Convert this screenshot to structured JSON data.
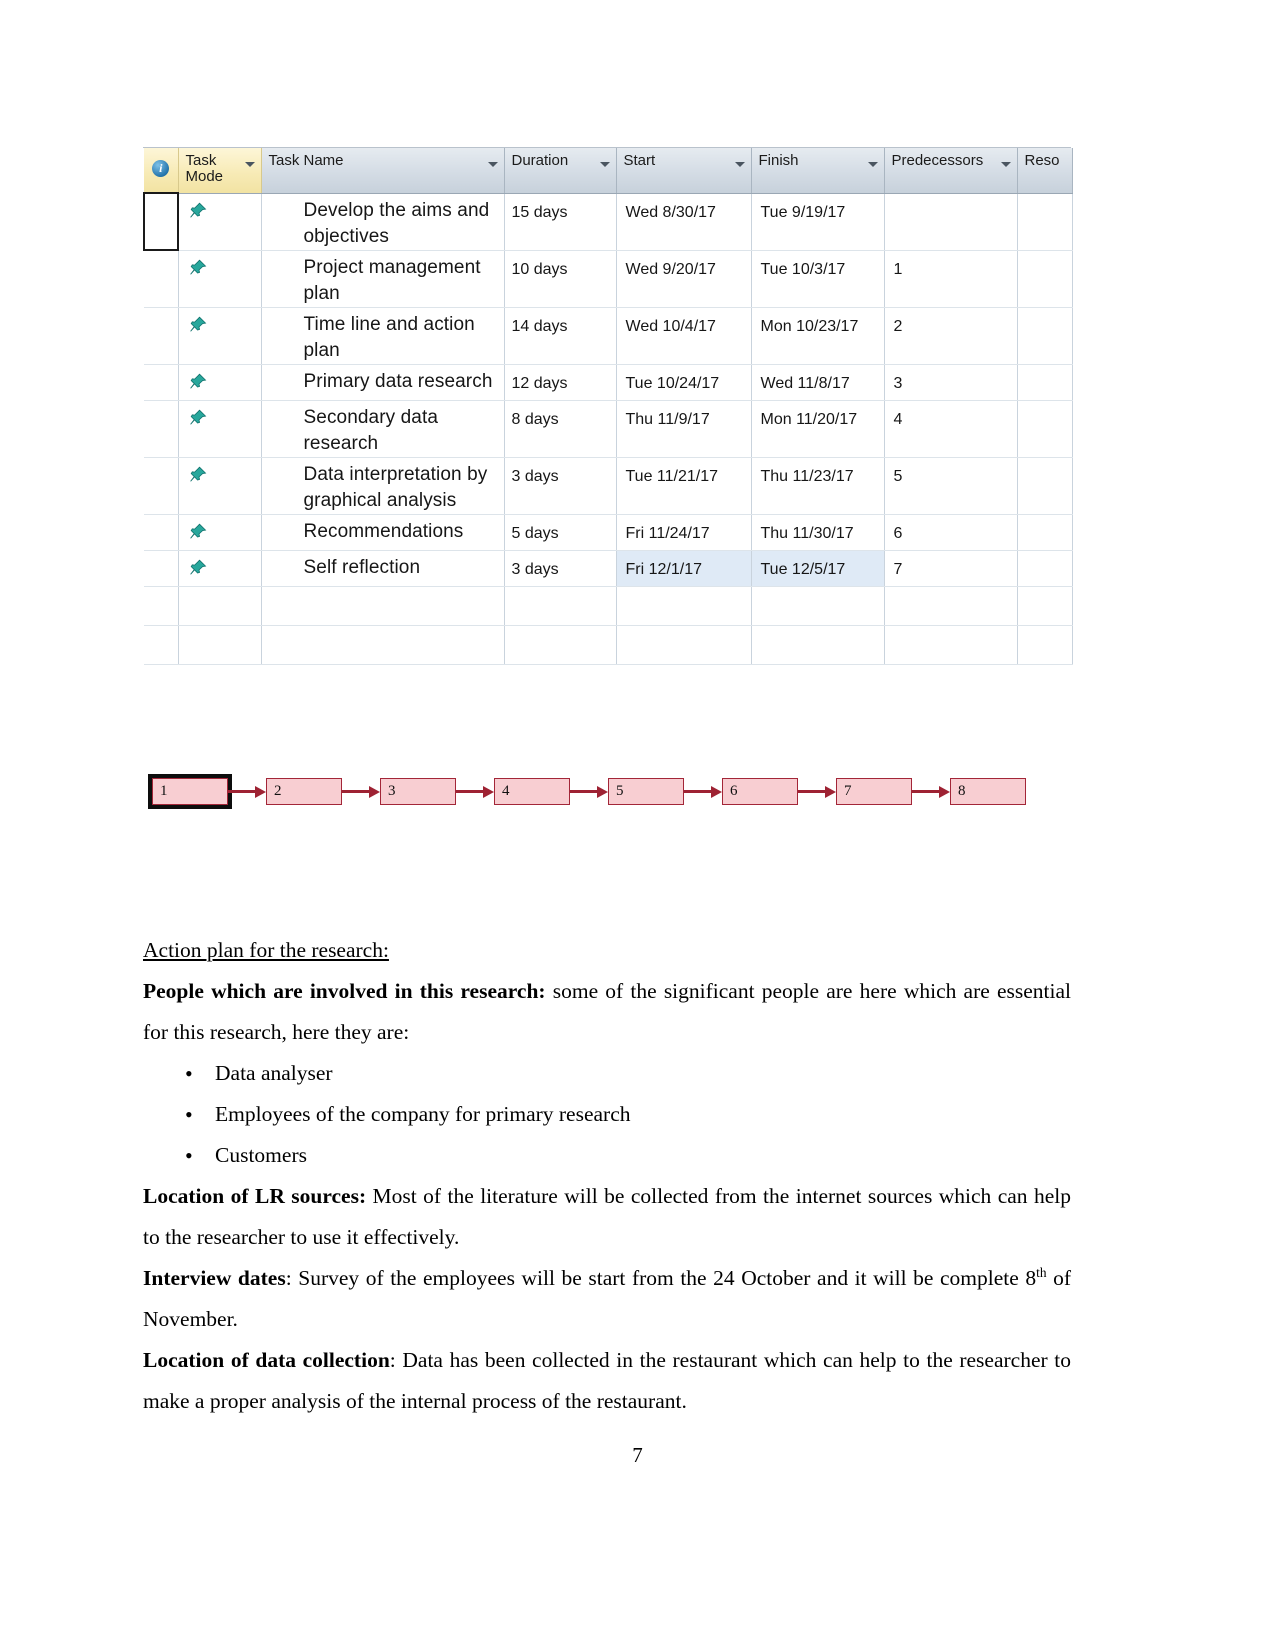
{
  "project_table": {
    "columns": [
      {
        "key": "indicator",
        "label": ""
      },
      {
        "key": "task_mode",
        "label": "Task Mode"
      },
      {
        "key": "task_name",
        "label": "Task Name"
      },
      {
        "key": "duration",
        "label": "Duration"
      },
      {
        "key": "start",
        "label": "Start"
      },
      {
        "key": "finish",
        "label": "Finish"
      },
      {
        "key": "predecessors",
        "label": "Predecessors"
      },
      {
        "key": "resources",
        "label": "Reso"
      }
    ],
    "rows": [
      {
        "task_name": "Develop the aims and objectives",
        "duration": "15 days",
        "start": "Wed 8/30/17",
        "finish": "Tue 9/19/17",
        "predecessors": ""
      },
      {
        "task_name": "Project management plan",
        "duration": "10 days",
        "start": "Wed 9/20/17",
        "finish": "Tue 10/3/17",
        "predecessors": "1"
      },
      {
        "task_name": "Time line and action plan",
        "duration": "14 days",
        "start": "Wed 10/4/17",
        "finish": "Mon 10/23/17",
        "predecessors": "2"
      },
      {
        "task_name": "Primary data research",
        "duration": "12 days",
        "start": "Tue 10/24/17",
        "finish": "Wed 11/8/17",
        "predecessors": "3"
      },
      {
        "task_name": "Secondary data research",
        "duration": "8 days",
        "start": "Thu 11/9/17",
        "finish": "Mon 11/20/17",
        "predecessors": "4"
      },
      {
        "task_name": "Data interpretation by graphical analysis",
        "duration": "3 days",
        "start": "Tue 11/21/17",
        "finish": "Thu 11/23/17",
        "predecessors": "5"
      },
      {
        "task_name": "Recommendations",
        "duration": "5 days",
        "start": "Fri 11/24/17",
        "finish": "Thu 11/30/17",
        "predecessors": "6"
      },
      {
        "task_name": "Self reflection",
        "duration": "3 days",
        "start": "Fri 12/1/17",
        "finish": "Tue 12/5/17",
        "predecessors": "7"
      }
    ],
    "colors": {
      "header_indicator_bg": "#f5e8b0",
      "header_bg": "#d4dce5",
      "selection_border": "#1a1a1a",
      "highlight_cell": "#dfeaf6",
      "pin_color": "#2aa8a0"
    }
  },
  "network_diagram": {
    "nodes": [
      "1",
      "2",
      "3",
      "4",
      "5",
      "6",
      "7",
      "8"
    ],
    "selected_node": "1",
    "node_fill": "#f8ced2",
    "node_border": "#a32638",
    "arrow_color": "#9e2233"
  },
  "document": {
    "heading": "Action plan for the research:",
    "people_label": "People which are involved in this research:",
    "people_text": " some of the significant people are here which are essential for this research, here they are:",
    "bullets": [
      "Data analyser",
      "Employees of the company for primary research",
      "Customers"
    ],
    "lr_label": "Location of LR sources:",
    "lr_text": " Most of the literature will be collected from the internet sources which can help to the researcher to use it effectively.",
    "interview_label": "Interview dates",
    "interview_text": ": Survey of the employees will be start from the 24 October and it will be complete 8",
    "interview_sup": "th",
    "interview_text2": " of November.",
    "collection_label": "Location of data collection",
    "collection_text": ": Data has been collected in the restaurant which can help to the researcher to make a proper analysis of the internal process of the restaurant.",
    "page_number": "7"
  }
}
